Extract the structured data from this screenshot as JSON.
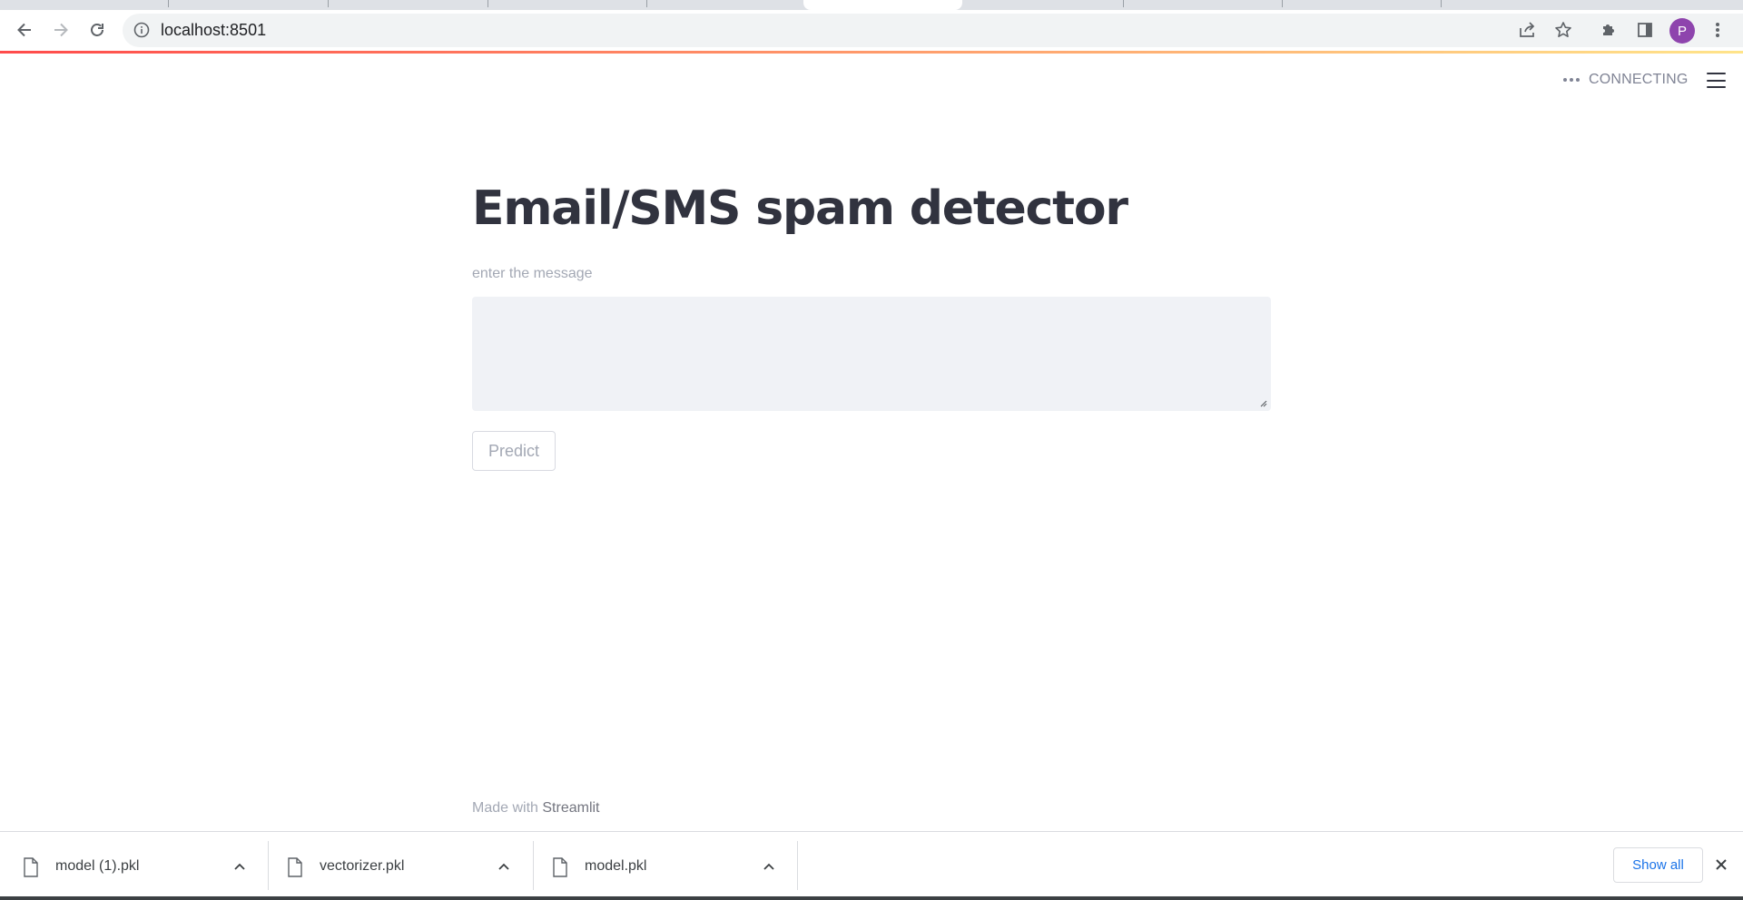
{
  "browser": {
    "url": "localhost:8501",
    "profile_initial": "P",
    "accent_color": "#8e44ad"
  },
  "app": {
    "status_text": "CONNECTING",
    "title": "Email/SMS spam detector",
    "input_label": "enter the message",
    "input_value": "",
    "predict_label": "Predict",
    "footer_prefix": "Made with ",
    "footer_brand": "Streamlit"
  },
  "downloads": {
    "items": [
      {
        "name": "model (1).pkl",
        "icon": "file-icon"
      },
      {
        "name": "vectorizer.pkl",
        "icon": "file-icon"
      },
      {
        "name": "model.pkl",
        "icon": "file-icon"
      }
    ],
    "show_all_label": "Show all"
  }
}
